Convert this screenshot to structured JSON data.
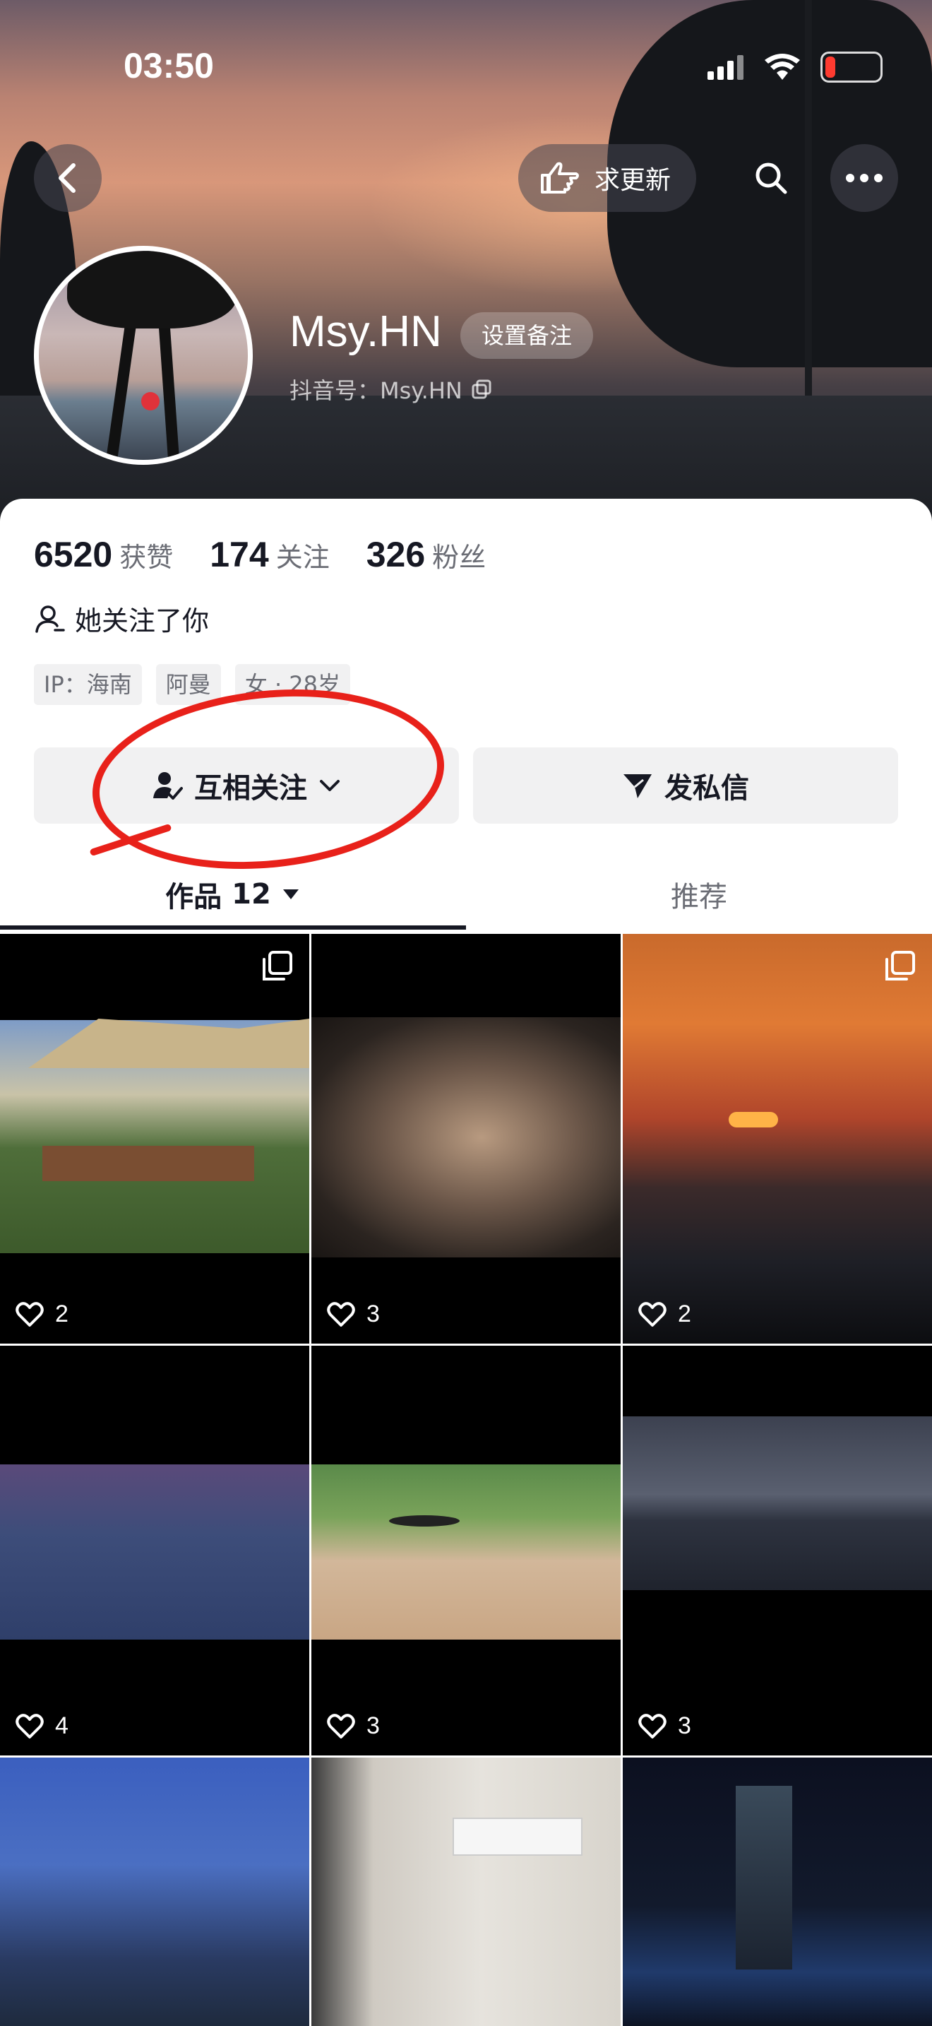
{
  "status": {
    "time": "03:50"
  },
  "header": {
    "back_icon": "chevron-left-icon",
    "request_update_label": "求更新",
    "search_icon": "search-icon",
    "more_icon": "more-icon"
  },
  "profile": {
    "name": "Msy.HN",
    "remark_button": "设置备注",
    "handle": "抖音号：Msy.HN",
    "stats": [
      {
        "value": "6520",
        "label": "获赞"
      },
      {
        "value": "174",
        "label": "关注"
      },
      {
        "value": "326",
        "label": "粉丝"
      }
    ],
    "follows_you": "她关注了你",
    "tags": [
      "IP：海南",
      "阿曼",
      "女 · 28岁"
    ]
  },
  "actions": {
    "mutual_follow": "互相关注",
    "message": "发私信"
  },
  "tabs": {
    "works_label": "作品",
    "works_count": "12",
    "recommend_label": "推荐"
  },
  "posts": [
    {
      "likes": "2",
      "multi": true
    },
    {
      "likes": "3",
      "multi": false
    },
    {
      "likes": "2",
      "multi": true
    },
    {
      "likes": "4",
      "multi": false
    },
    {
      "likes": "3",
      "multi": false
    },
    {
      "likes": "3",
      "multi": false
    },
    {
      "likes": "",
      "multi": false
    },
    {
      "likes": "",
      "multi": false
    },
    {
      "likes": "",
      "multi": false
    }
  ],
  "colors": {
    "annotation": "#e8211a",
    "text": "#161823",
    "muted": "#6b6d75"
  }
}
